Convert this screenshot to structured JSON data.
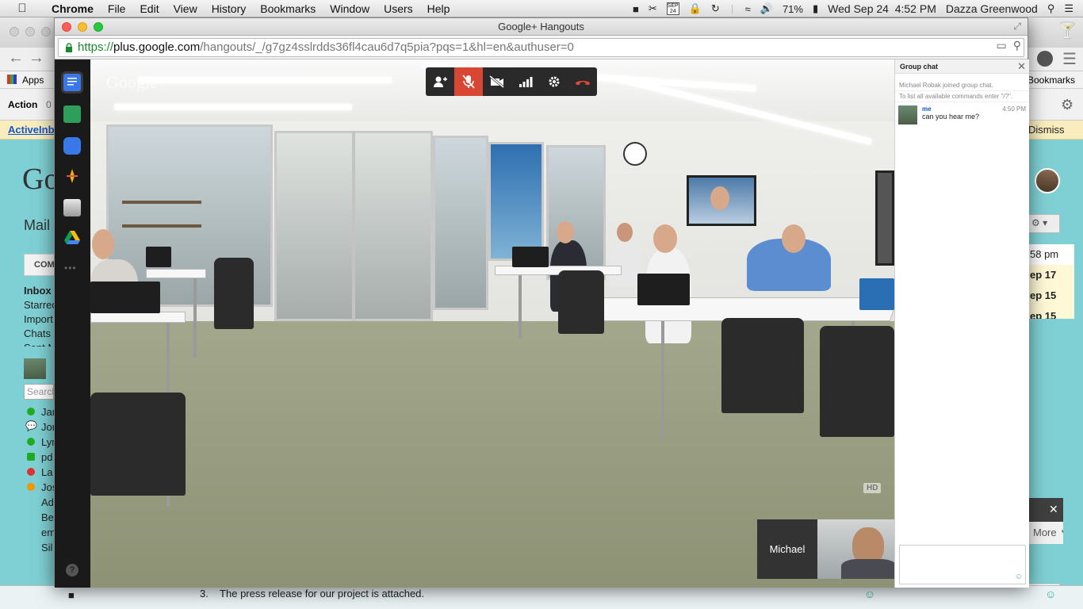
{
  "menubar": {
    "items": [
      "Chrome",
      "File",
      "Edit",
      "View",
      "History",
      "Bookmarks",
      "Window",
      "Users",
      "Help"
    ],
    "calendar_month": "SEP",
    "calendar_day": "24",
    "battery": "71%",
    "clock": "Wed Sep 24  4:52 PM",
    "user": "Dazza Greenwood"
  },
  "background": {
    "bookmarks_apps": "Apps",
    "bookmarks_right": "Bookmarks",
    "action_label": "Action",
    "action_count": "0",
    "notice_link": "ActiveInb",
    "notice_dismiss": "Dismiss",
    "google_logo": "Go",
    "mail_label": "Mail",
    "compose_label": "COM",
    "nav": [
      "Inbox",
      "Starred",
      "Import",
      "Chats",
      "Sent M"
    ],
    "search_placeholder": "Search",
    "contacts": [
      "Jan",
      "Jon",
      "Lyn",
      "pd",
      "La",
      "Jos",
      "Ad",
      "Be",
      "em",
      "Sil"
    ],
    "right_times": [
      "58 pm",
      "ep 17",
      "ep 15",
      "ep 15"
    ],
    "more_label": "More ▼",
    "bottom_text": "3.    The press release for our project is attached."
  },
  "window": {
    "title": "Google+ Hangouts",
    "url_scheme": "https://",
    "url_host": "plus.google.com",
    "url_path": "/hangouts/_/g7gz4sslrdds36fl4cau6d7q5pia?pqs=1&hl=en&authuser=0"
  },
  "hangout": {
    "logo": "Google+",
    "hd_badge": "HD",
    "participant_name": "Michael",
    "toolbar_icons": [
      "add-person-icon",
      "mic-muted-icon",
      "camera-off-icon",
      "bandwidth-icon",
      "settings-icon",
      "hangup-icon"
    ],
    "colors": {
      "accent_red": "#d84634",
      "toolbar_bg": "#2a2a2a"
    }
  },
  "chat": {
    "title": "Group chat",
    "system_messages": [
      "Michael Robak joined group chat.",
      "To list all available commands enter \"/?\"."
    ],
    "message": {
      "sender": "me",
      "time": "4:50 PM",
      "text": "can you hear me?"
    }
  }
}
